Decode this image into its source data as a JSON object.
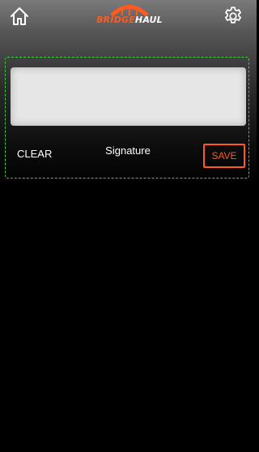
{
  "header": {
    "logo": {
      "part1": "BRIDGE",
      "part2": "HAUL"
    },
    "home_icon": "home-icon",
    "settings_icon": "gear-icon"
  },
  "signature_panel": {
    "clear_label": "CLEAR",
    "title": "Signature",
    "save_label": "SAVE"
  },
  "colors": {
    "accent": "#ff5a1f",
    "panel_outline": "#37d23a",
    "pad_background": "#e6e6e6"
  }
}
